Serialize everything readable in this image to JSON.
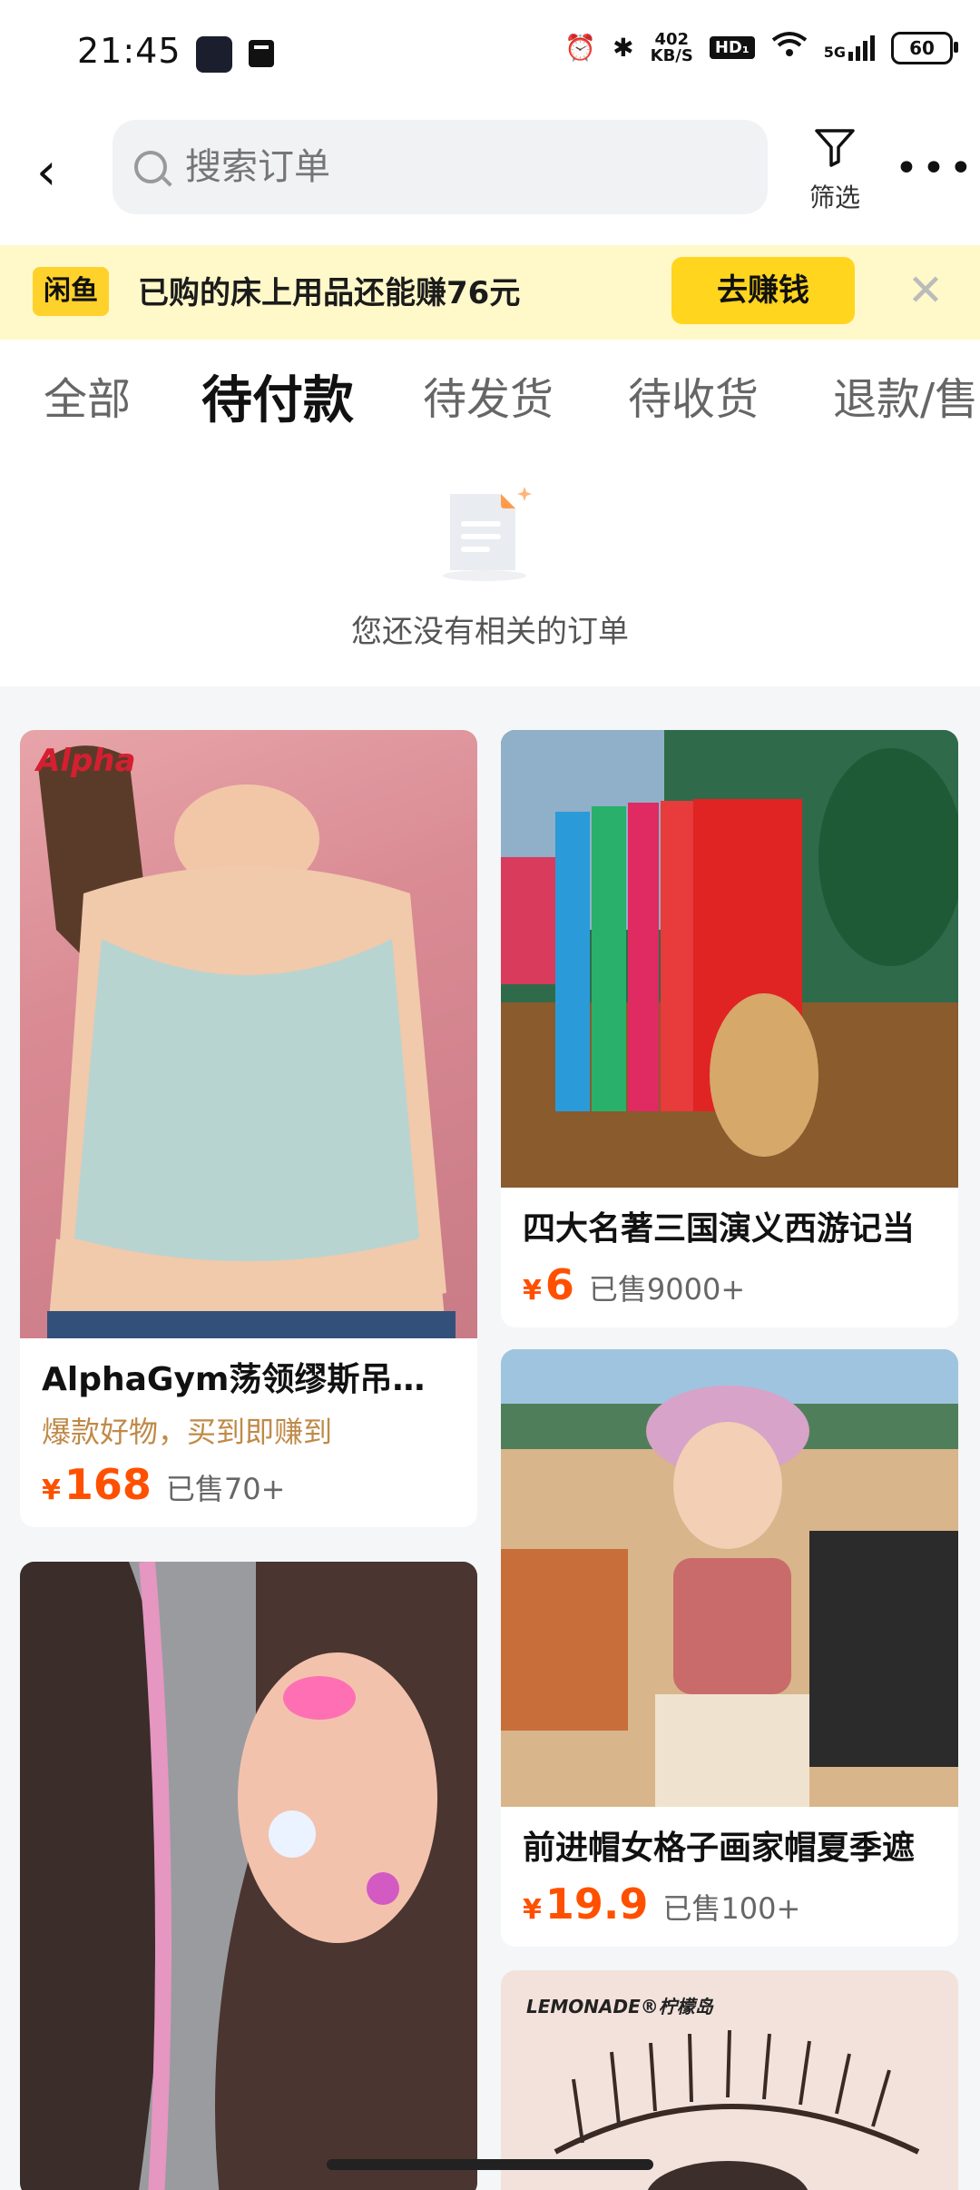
{
  "status": {
    "time": "21:45",
    "network_speed_value": "402",
    "network_speed_unit": "KB/S",
    "hd_label": "HD₁",
    "signal_label": "5G",
    "battery": "60"
  },
  "header": {
    "search_placeholder": "搜索订单",
    "filter_label": "筛选",
    "more_label": "•••",
    "back_label": "‹"
  },
  "banner": {
    "logo": "闲鱼",
    "text": "已购的床上用品还能赚76元",
    "button": "去赚钱",
    "close": "✕"
  },
  "tabs": [
    "全部",
    "待付款",
    "待发货",
    "待收货",
    "退款/售"
  ],
  "active_tab_index": 1,
  "empty": {
    "text": "您还没有相关的订单"
  },
  "products": [
    {
      "title": "AlphaGym荡领缪斯吊带女",
      "promo": "爆款好物，买到即赚到",
      "price": "168",
      "currency": "¥",
      "sold": "已售70+",
      "watermark": "Alpha"
    },
    {
      "title": "四大名著三国演义西游记当",
      "price": "6",
      "currency": "¥",
      "sold": "已售9000+"
    },
    {
      "title": "前进帽女格子画家帽夏季遮",
      "price": "19.9",
      "currency": "¥",
      "sold": "已售100+"
    },
    {
      "watermark": "LEMONADE®柠檬岛"
    }
  ],
  "colors": {
    "price": "#ff5000",
    "banner_bg": "#fff8c9",
    "accent_yellow": "#ffd51e",
    "promo": "#bf8a48"
  }
}
